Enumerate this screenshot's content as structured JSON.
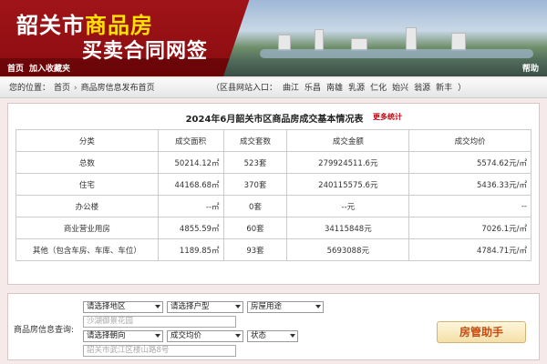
{
  "header": {
    "title_city": "韶关市",
    "title_product": "商品房",
    "title_line2": "买卖合同网签",
    "nav_home": "首页",
    "nav_favorite": "加入收藏夹",
    "nav_help": "帮助"
  },
  "breadcrumb": {
    "location_label": "您的位置：",
    "home": "首页",
    "separator": "›",
    "current": "商品房信息发布首页",
    "county_label": "（区县网站入口：",
    "counties": [
      "曲江",
      "乐昌",
      "南雄",
      "乳源",
      "仁化",
      "始兴",
      "翁源",
      "新丰"
    ],
    "county_close": "）"
  },
  "stats": {
    "title": "2024年6月韶关市区商品房成交基本情况表",
    "more_link": "更多统计",
    "columns": [
      "分类",
      "成交面积",
      "成交套数",
      "成交金额",
      "成交均价"
    ],
    "rows": [
      [
        "总数",
        "50214.12㎡",
        "523套",
        "279924511.6元",
        "5574.62元/㎡"
      ],
      [
        "住宅",
        "44168.68㎡",
        "370套",
        "240115575.6元",
        "5436.33元/㎡"
      ],
      [
        "办公楼",
        "--㎡",
        "0套",
        "--元",
        "--"
      ],
      [
        "商业营业用房",
        "4855.59㎡",
        "60套",
        "34115848元",
        "7026.1元/㎡"
      ],
      [
        "其他（包含车房、车库、车位）",
        "1189.85㎡",
        "93套",
        "5693088元",
        "4784.71元/㎡"
      ]
    ]
  },
  "query": {
    "label": "商品房信息查询:",
    "region_select": "请选择地区",
    "type_select": "请选择户型",
    "usage_select": "房屋用途",
    "project_placeholder": "沙湖御景花园",
    "direction_select": "请选择朝向",
    "price_select": "成交均价",
    "status_select": "状态",
    "address_placeholder": "韶关市武江区楼山路8号",
    "helper_button": "房管助手"
  }
}
